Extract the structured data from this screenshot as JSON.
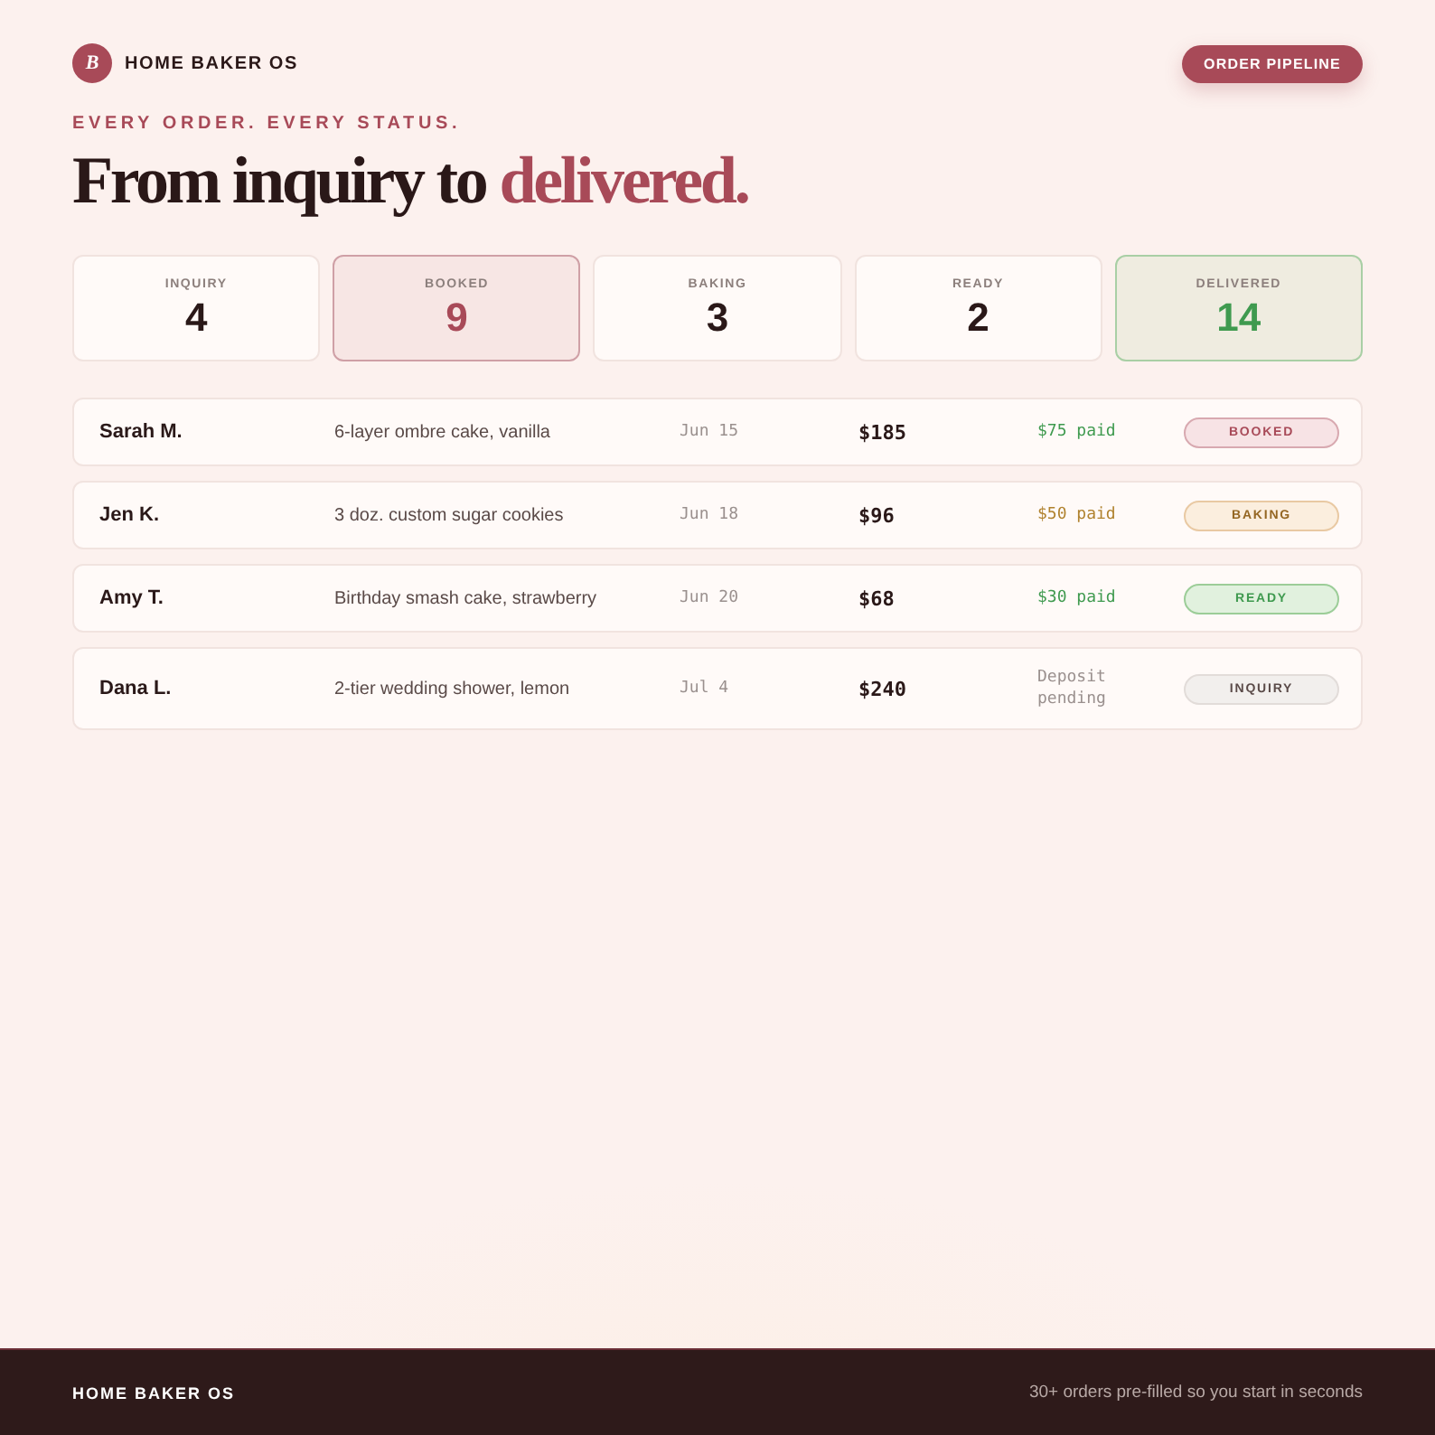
{
  "brand": {
    "logo_letter": "B",
    "name": "HOME BAKER OS"
  },
  "nav_button": {
    "label": "ORDER PIPELINE"
  },
  "eyebrow": "EVERY ORDER. EVERY STATUS.",
  "headline": {
    "text": "From inquiry to",
    "accent": "delivered."
  },
  "stages": [
    {
      "label": "INQUIRY",
      "count": "4",
      "kind": "plain"
    },
    {
      "label": "BOOKED",
      "count": "9",
      "kind": "accent"
    },
    {
      "label": "BAKING",
      "count": "3",
      "kind": "plain"
    },
    {
      "label": "READY",
      "count": "2",
      "kind": "plain"
    },
    {
      "label": "DELIVERED",
      "count": "14",
      "kind": "done"
    }
  ],
  "orders": [
    {
      "customer": "Sarah M.",
      "item": "6-layer ombre cake, vanilla",
      "date": "Jun 15",
      "total": "$185",
      "payment": {
        "text": "$75 paid",
        "kind": "paid"
      },
      "status": {
        "label": "BOOKED",
        "kind": "booked"
      }
    },
    {
      "customer": "Jen K.",
      "item": "3 doz. custom sugar cookies",
      "date": "Jun 18",
      "total": "$96",
      "payment": {
        "text": "$50 paid",
        "kind": "partial"
      },
      "status": {
        "label": "BAKING",
        "kind": "baking"
      }
    },
    {
      "customer": "Amy T.",
      "item": "Birthday smash cake, strawberry",
      "date": "Jun 20",
      "total": "$68",
      "payment": {
        "text": "$30 paid",
        "kind": "paid"
      },
      "status": {
        "label": "READY",
        "kind": "ready"
      }
    },
    {
      "customer": "Dana L.",
      "item": "2-tier wedding shower, lemon",
      "date": "Jul 4",
      "total": "$240",
      "payment": {
        "text": "Deposit pending",
        "kind": "pending"
      },
      "status": {
        "label": "INQUIRY",
        "kind": "inquiry"
      }
    }
  ],
  "footer": {
    "brand": "HOME BAKER OS",
    "tagline": "30+ orders pre-filled so you start in seconds"
  }
}
